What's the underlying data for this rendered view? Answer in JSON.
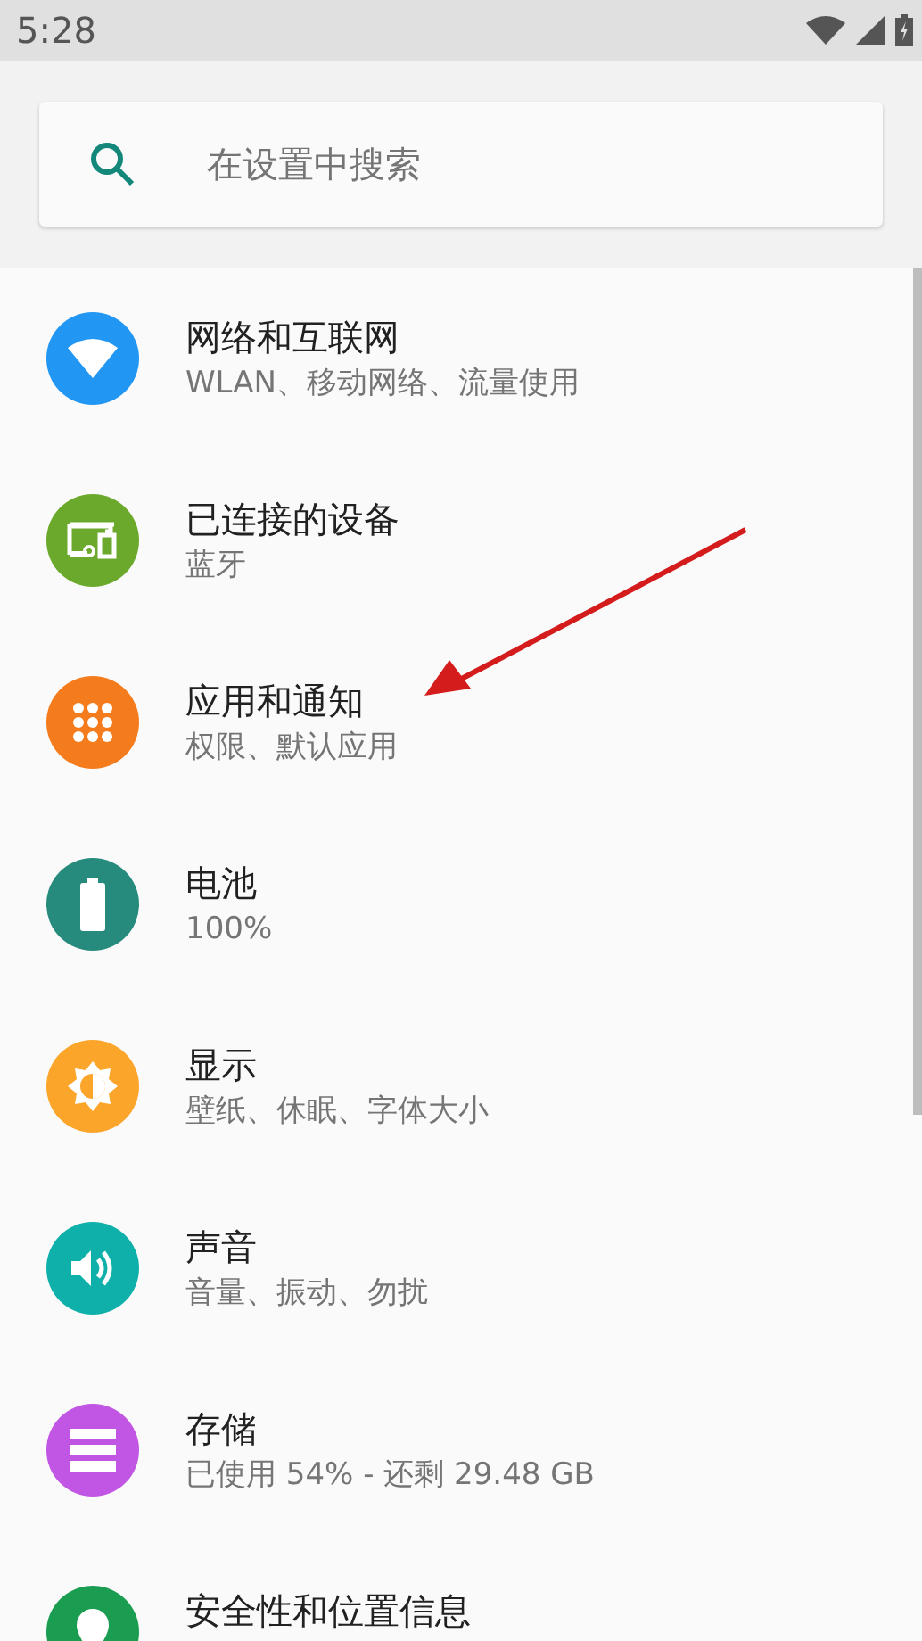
{
  "status_bar": {
    "time": "5:28"
  },
  "search": {
    "placeholder": "在设置中搜索"
  },
  "items": [
    {
      "kind": "network",
      "color": "#2196f3",
      "title": "网络和互联网",
      "subtitle": "WLAN、移动网络、流量使用"
    },
    {
      "kind": "devices",
      "color": "#6aa92b",
      "title": "已连接的设备",
      "subtitle": "蓝牙"
    },
    {
      "kind": "apps",
      "color": "#f57c1c",
      "title": "应用和通知",
      "subtitle": "权限、默认应用"
    },
    {
      "kind": "battery",
      "color": "#268a7c",
      "title": "电池",
      "subtitle": "100%"
    },
    {
      "kind": "display",
      "color": "#fba52a",
      "title": "显示",
      "subtitle": "壁纸、休眠、字体大小"
    },
    {
      "kind": "sound",
      "color": "#10b0aa",
      "title": "声音",
      "subtitle": "音量、振动、勿扰"
    },
    {
      "kind": "storage",
      "color": "#c156e4",
      "title": "存储",
      "subtitle": "已使用 54% - 还剩 29.48 GB"
    },
    {
      "kind": "security",
      "color": "#1a9d50",
      "title": "安全性和位置信息"
    }
  ]
}
